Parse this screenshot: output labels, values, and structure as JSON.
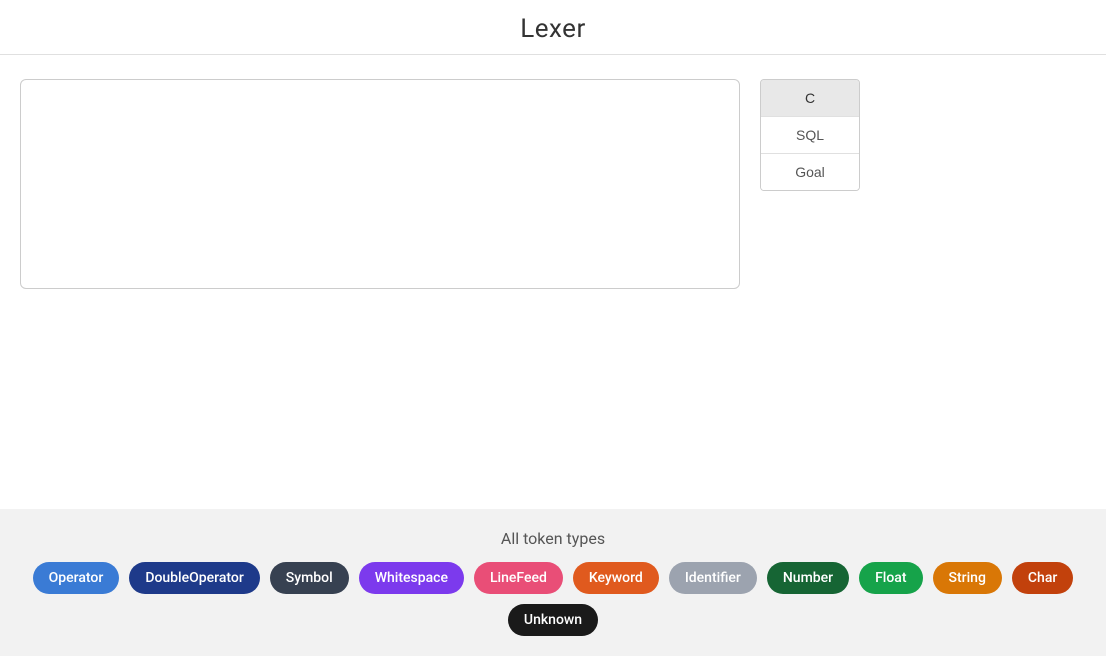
{
  "header": {
    "title": "Lexer"
  },
  "textarea": {
    "placeholder": "",
    "value": ""
  },
  "lang_selector": {
    "options": [
      {
        "label": "C",
        "selected": true
      },
      {
        "label": "SQL",
        "selected": false
      },
      {
        "label": "Goal",
        "selected": false
      }
    ]
  },
  "token_legend": {
    "title": "All token types",
    "tokens": [
      {
        "label": "Operator",
        "class": "chip-operator"
      },
      {
        "label": "DoubleOperator",
        "class": "chip-double-op"
      },
      {
        "label": "Symbol",
        "class": "chip-symbol"
      },
      {
        "label": "Whitespace",
        "class": "chip-whitespace"
      },
      {
        "label": "LineFeed",
        "class": "chip-linefeed"
      },
      {
        "label": "Keyword",
        "class": "chip-keyword"
      },
      {
        "label": "Identifier",
        "class": "chip-identifier"
      },
      {
        "label": "Number",
        "class": "chip-number"
      },
      {
        "label": "Float",
        "class": "chip-float"
      },
      {
        "label": "String",
        "class": "chip-string"
      },
      {
        "label": "Char",
        "class": "chip-char"
      },
      {
        "label": "Unknown",
        "class": "chip-unknown"
      }
    ]
  }
}
